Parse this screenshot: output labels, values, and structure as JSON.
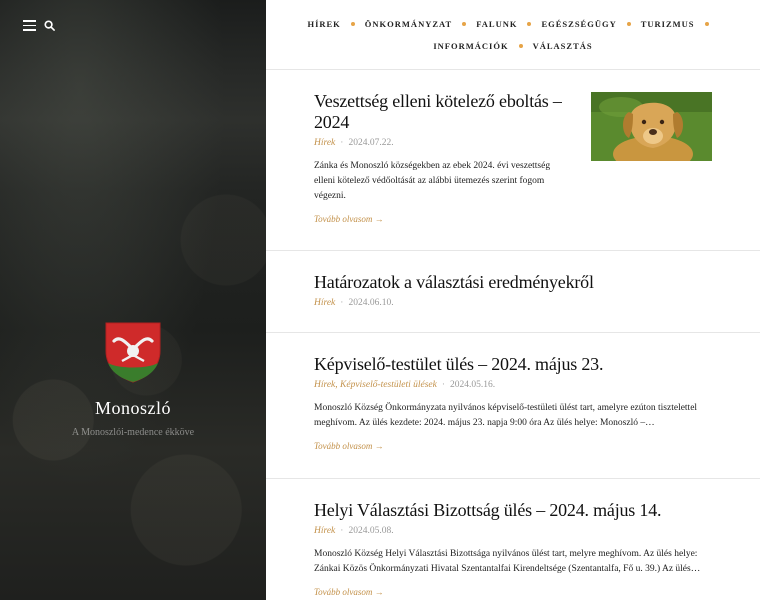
{
  "header": {
    "site_title": "Monoszló",
    "tagline": "A Monoszlói-medence ékköve",
    "icons": [
      "menu-icon",
      "search-icon"
    ]
  },
  "nav": {
    "row1": [
      "HÍREK",
      "ÖNKORMÁNYZAT",
      "FALUNK",
      "EGÉSZSÉGÜGY",
      "TURIZMUS"
    ],
    "row2": [
      "INFORMÁCIÓK",
      "VÁLASZTÁS"
    ],
    "accent": "#e6a447"
  },
  "posts": [
    {
      "title": "Veszettség elleni kötelező eboltás – 2024",
      "categories": "Hírek",
      "date": "2024.07.22.",
      "excerpt": "Zánka és Monoszló községekben az ebek 2024. évi veszettség elleni kötelező védőoltását az alábbi ütemezés szerint fogom végezni.",
      "more": "Tovább olvasom →"
    },
    {
      "title": "Határozatok a választási eredményekről",
      "categories": "Hírek",
      "date": "2024.06.10."
    },
    {
      "title": "Képviselő-testület ülés – 2024. május 23.",
      "categories": "Hírek, Képviselő-testületi ülések",
      "date": "2024.05.16.",
      "excerpt": "Monoszló Község Önkormányzata nyilvános képviselő-testületi ülést tart, amelyre ezúton tisztelettel meghívom. Az ülés kezdete: 2024. május 23. napja 9:00 óra Az ülés helye: Monoszló –…",
      "more": "Tovább olvasom →"
    },
    {
      "title": "Helyi Választási Bizottság ülés – 2024. május 14.",
      "categories": "Hírek",
      "date": "2024.05.08.",
      "excerpt": "Monoszló Község Helyi Választási Bizottsága nyilvános ülést tart, melyre meghívom. Az ülés helye: Zánkai Közös Önkormányzati Hivatal Szentantalfai Kirendeltsége (Szentantalfa, Fő u. 39.) Az ülés…",
      "more": "Tovább olvasom →"
    }
  ],
  "colors": {
    "link": "#c3914a",
    "sidebar_bg": "#232523"
  }
}
